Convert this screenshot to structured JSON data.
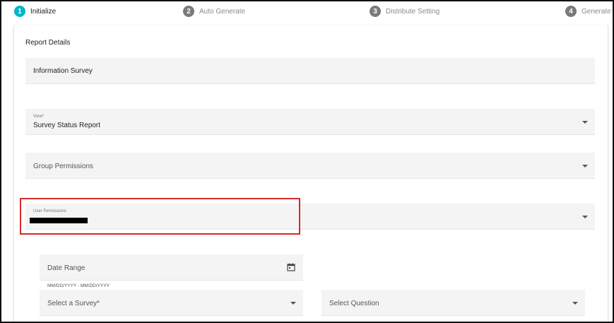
{
  "stepper": {
    "steps": [
      {
        "number": "1",
        "label": "Initialize",
        "state": "active"
      },
      {
        "number": "2",
        "label": "Auto Generate",
        "state": "inactive"
      },
      {
        "number": "3",
        "label": "Distribute Setting",
        "state": "inactive"
      },
      {
        "number": "4",
        "label": "Generate",
        "state": "inactive"
      }
    ],
    "active_color": "#00b5c8",
    "inactive_color": "#7a7a7a"
  },
  "form": {
    "section_title": "Report Details",
    "report_name": {
      "value": "Information Survey"
    },
    "view": {
      "label": "View*",
      "value": "Survey Status Report",
      "icon": "chevron-down-icon"
    },
    "group_permissions": {
      "placeholder": "Group Permissions",
      "icon": "chevron-down-icon"
    },
    "user_permissions": {
      "label": "User Permissions",
      "value_redacted": true,
      "icon": "chevron-down-icon"
    },
    "date_range": {
      "placeholder": "Date Range",
      "hint": "MM/DD/YYYY - MM/DD/YYYY",
      "icon": "calendar-icon"
    },
    "select_survey": {
      "placeholder": "Select a Survey*",
      "icon": "chevron-down-icon"
    },
    "select_question": {
      "placeholder": "Select Question",
      "icon": "chevron-down-icon"
    }
  },
  "highlight_color": "#d42a2a"
}
